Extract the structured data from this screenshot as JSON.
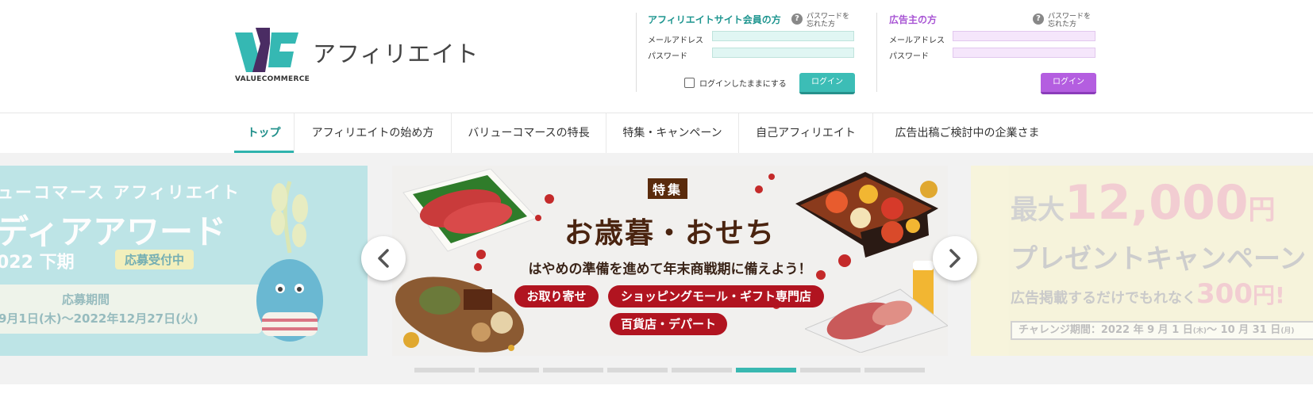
{
  "header": {
    "brand_word": "VALUECOMMERCE",
    "site_title": "アフィリエイト",
    "affiliate_panel": {
      "title": "アフィリエイトサイト会員の方",
      "forgot_password": [
        "パスワードを",
        "忘れた方"
      ],
      "email_label": "メールアドレス",
      "password_label": "パスワード",
      "keep_login_label": "ログインしたままにする",
      "login_button": "ログイン"
    },
    "advertiser_panel": {
      "title": "広告主の方",
      "forgot_password": [
        "パスワードを",
        "忘れた方"
      ],
      "email_label": "メールアドレス",
      "password_label": "パスワード",
      "login_button": "ログイン"
    }
  },
  "nav": {
    "items": [
      {
        "label": "トップ",
        "active": true
      },
      {
        "label": "アフィリエイトの始め方",
        "active": false
      },
      {
        "label": "バリューコマースの特長",
        "active": false
      },
      {
        "label": "特集・キャンペーン",
        "active": false
      },
      {
        "label": "自己アフィリエイト",
        "active": false
      },
      {
        "label": "広告出稿ご検討中の企業さま",
        "active": false
      }
    ]
  },
  "carousel": {
    "left_slide": {
      "line1": "ューコマース アフィリエイト",
      "line2": "ディアアワード",
      "line3": "022 下期",
      "badge": "応募受付中",
      "period_label": "応募期間",
      "period": "9月1日(木)～2022年12月27日(火)"
    },
    "center_slide": {
      "tag": "特集",
      "headline": "お歳暮・おせち",
      "subline": "はやめの準備を進めて年末商戦期に備えよう！",
      "pills": [
        "お取り寄せ",
        "ショッピングモール・ギフト専門店",
        "百貨店・デパート"
      ]
    },
    "right_slide": {
      "line1_a": "最大",
      "line1_b": "12,000",
      "line1_c": "円",
      "line2": "プレゼントキャンペーン",
      "line3_a": "広告掲載するだけでもれなく",
      "line3_b": "300",
      "line3_c": "円!",
      "period": "チャレンジ期間：2022 年 9 月 1 日",
      "period_dow1": "(木)",
      "period_mid": "～ 10 月 31 日",
      "period_dow2": "(月)"
    },
    "prev_icon": "chevron-left-icon",
    "next_icon": "chevron-right-icon",
    "dots_total": 8,
    "active_dot": 6
  },
  "colors": {
    "accent_teal": "#3cbdb6",
    "accent_purple": "#b45ee0",
    "feature_red": "#b11420"
  }
}
